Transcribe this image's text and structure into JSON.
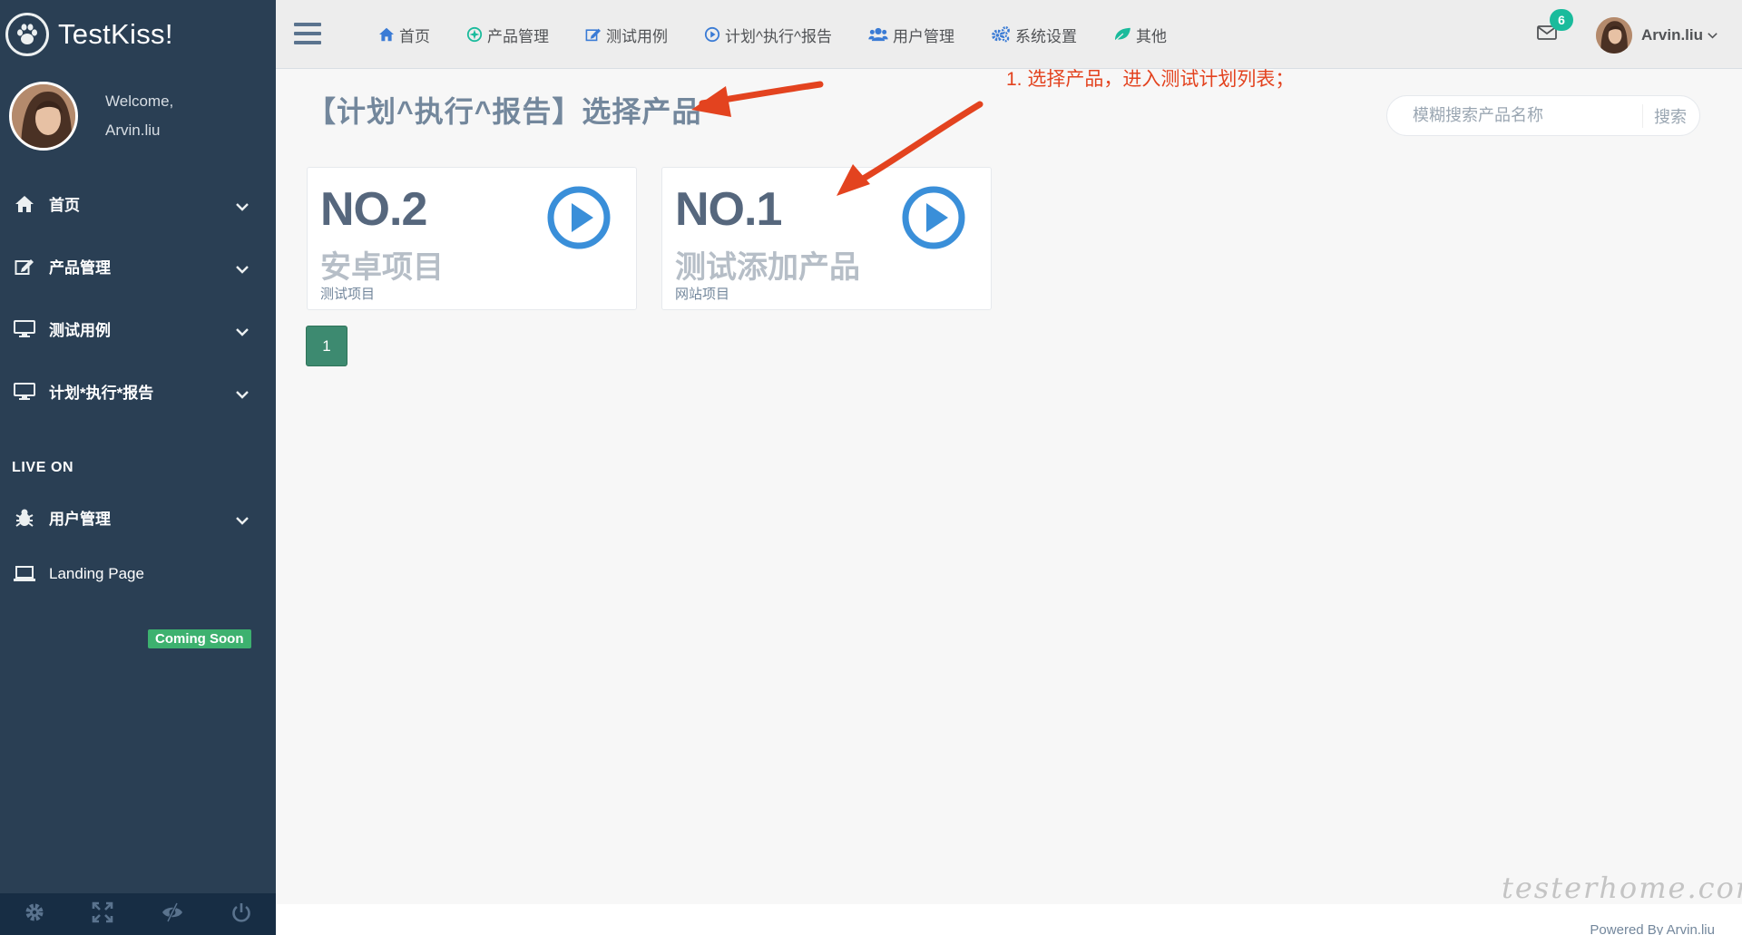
{
  "brand": {
    "name": "TestKiss!"
  },
  "profile": {
    "welcome": "Welcome,",
    "name": "Arvin.liu"
  },
  "sidebar": {
    "items": [
      {
        "label": "首页"
      },
      {
        "label": "产品管理"
      },
      {
        "label": "测试用例"
      },
      {
        "label": "计划*执行*报告"
      }
    ],
    "section_label": "LIVE ON",
    "live_items": [
      {
        "label": "用户管理"
      },
      {
        "label": "Landing Page"
      }
    ],
    "coming_soon": "Coming Soon"
  },
  "topnav": {
    "items": [
      {
        "label": "首页",
        "icon": "home-icon",
        "color": "#3a7bd5"
      },
      {
        "label": "产品管理",
        "icon": "gear-leaf-icon",
        "color": "#1abb9c"
      },
      {
        "label": "测试用例",
        "icon": "edit-icon",
        "color": "#3a7bd5"
      },
      {
        "label": "计划^执行^报告",
        "icon": "play-circle-icon",
        "color": "#3a7bd5"
      },
      {
        "label": "用户管理",
        "icon": "users-icon",
        "color": "#3a7bd5"
      },
      {
        "label": "系统设置",
        "icon": "cogs-icon",
        "color": "#3a7bd5"
      },
      {
        "label": "其他",
        "icon": "leaf-icon",
        "color": "#1abb9c"
      }
    ],
    "mail_count": "6",
    "user_name": "Arvin.liu"
  },
  "main": {
    "title": "【计划^执行^报告】选择产品",
    "annotation": "1. 选择产品，进入测试计划列表；",
    "search": {
      "placeholder": "模糊搜索产品名称",
      "button": "搜索"
    },
    "products": [
      {
        "no": "NO.2",
        "name": "安卓项目",
        "type": "测试项目"
      },
      {
        "no": "NO.1",
        "name": "测试添加产品",
        "type": "网站项目"
      }
    ],
    "pagination": {
      "current": "1"
    }
  },
  "footer": {
    "text": "Powered By Arvin.liu"
  },
  "watermark": "testerhome.com",
  "colors": {
    "sidebar": "#2a3f54",
    "accent": "#1abb9c",
    "play": "#3a8fd9",
    "arrow": "#e3431f"
  }
}
